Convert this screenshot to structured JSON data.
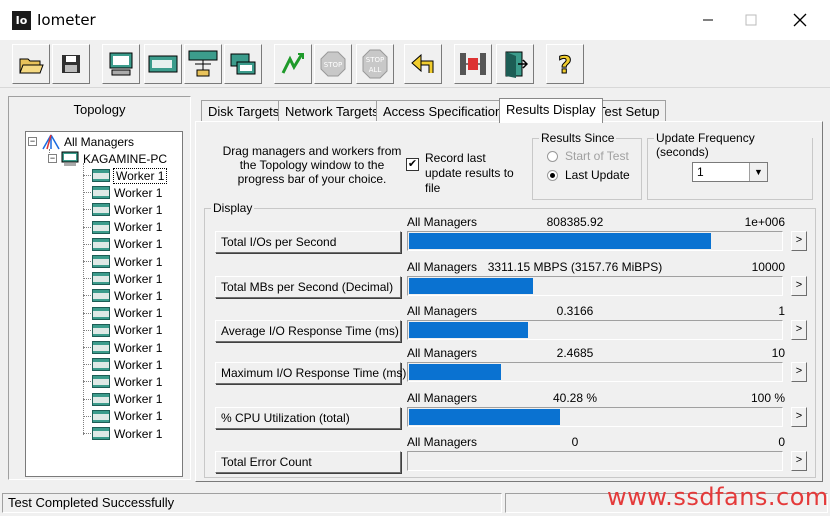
{
  "window": {
    "title": "Iometer",
    "icon_text": "Io"
  },
  "toolbar": {
    "buttons": [
      {
        "name": "open-icon"
      },
      {
        "name": "save-icon"
      },
      {
        "name": "new-manager-icon"
      },
      {
        "name": "new-worker-icon"
      },
      {
        "name": "network-worker-icon"
      },
      {
        "name": "copy-worker-icon"
      },
      {
        "name": "start-icon"
      },
      {
        "name": "stop-icon",
        "label": "STOP"
      },
      {
        "name": "stop-all-icon",
        "label": "STOP ALL"
      },
      {
        "name": "reset-workers-icon"
      },
      {
        "name": "disconnect-icon"
      },
      {
        "name": "exit-icon"
      },
      {
        "name": "about-icon",
        "label": "?"
      }
    ]
  },
  "topology": {
    "title": "Topology",
    "root": "All Managers",
    "manager": "KAGAMINE-PC",
    "workers": [
      "Worker 1",
      "Worker 1",
      "Worker 1",
      "Worker 1",
      "Worker 1",
      "Worker 1",
      "Worker 1",
      "Worker 1",
      "Worker 1",
      "Worker 1",
      "Worker 1",
      "Worker 1",
      "Worker 1",
      "Worker 1",
      "Worker 1",
      "Worker 1"
    ]
  },
  "tabs": [
    "Disk Targets",
    "Network Targets",
    "Access Specifications",
    "Results Display",
    "Test Setup"
  ],
  "active_tab": "Results Display",
  "results": {
    "drag_text": "Drag managers and workers from the Topology window to the progress bar of your choice.",
    "record_label": "Record last update results to file",
    "record_checked": "✔",
    "results_since": {
      "title": "Results Since",
      "option_start": "Start of Test",
      "option_last": "Last Update",
      "selected": "Last Update"
    },
    "update_frequency": {
      "title": "Update Frequency (seconds)",
      "value": "1"
    },
    "display_title": "Display",
    "rows": [
      {
        "label": "Total I/Os per Second",
        "source": "All Managers",
        "value": "808385.92",
        "max": "1e+006",
        "fill": 0.808
      },
      {
        "label": "Total MBs per Second (Decimal)",
        "source": "All Managers",
        "value": "3311.15 MBPS (3157.76 MiBPS)",
        "max": "10000",
        "fill": 0.331
      },
      {
        "label": "Average I/O Response Time (ms)",
        "source": "All Managers",
        "value": "0.3166",
        "max": "1",
        "fill": 0.317
      },
      {
        "label": "Maximum I/O Response Time (ms)",
        "source": "All Managers",
        "value": "2.4685",
        "max": "10",
        "fill": 0.247
      },
      {
        "label": "% CPU Utilization (total)",
        "source": "All Managers",
        "value": "40.28 %",
        "max": "100 %",
        "fill": 0.403
      },
      {
        "label": "Total Error Count",
        "source": "All Managers",
        "value": "0",
        "max": "0",
        "fill": 0
      }
    ],
    "row_arrow": ">"
  },
  "status": {
    "text": "Test Completed Successfully"
  },
  "watermark": "www.ssdfans.com",
  "colors": {
    "bar": "#0a72d1",
    "watermark": "#e43a3a"
  }
}
